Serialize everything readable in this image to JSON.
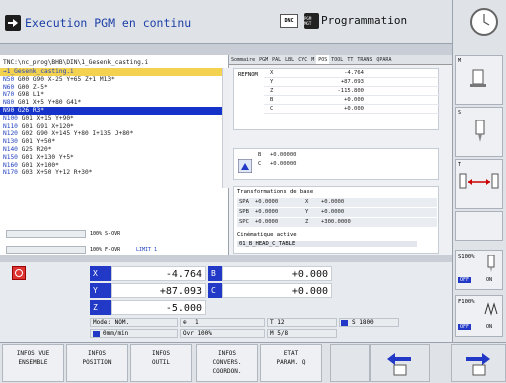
{
  "header": {
    "mode_title": "Execution PGM en continu",
    "dnc": "DNC",
    "prog_icon": "PGM MGT",
    "prog_title": "Programmation"
  },
  "program": {
    "path": "TNC:\\nc_prog\\BHB\\DIN\\1_Gesenk_casting.i",
    "lines": [
      {
        "n": "→1_Gesenk_casting.i",
        "t": "",
        "style": "yellow"
      },
      {
        "n": "N50",
        "t": " G00 G90 X-25 Y+65 Z+1 M13*",
        "style": ""
      },
      {
        "n": "N60",
        "t": " G00 Z-5*",
        "style": ""
      },
      {
        "n": "N70",
        "t": " G98 L1*",
        "style": ""
      },
      {
        "n": "N80",
        "t": " G01 X+5 Y+80 G41*",
        "style": ""
      },
      {
        "n": "N90",
        "t": " G26 R3*",
        "style": "blue"
      },
      {
        "n": "N100",
        "t": " G01 X+15 Y+90*",
        "style": ""
      },
      {
        "n": "N110",
        "t": " G01 G91 X+120*",
        "style": ""
      },
      {
        "n": "N120",
        "t": " G02 G90 X+145 Y+80 I+135 J+80*",
        "style": ""
      },
      {
        "n": "N130",
        "t": " G01 Y+50*",
        "style": ""
      },
      {
        "n": "N140",
        "t": " G25 R20*",
        "style": ""
      },
      {
        "n": "N150",
        "t": " G01 X+130 Y+5*",
        "style": ""
      },
      {
        "n": "N160",
        "t": " G01 X+100*",
        "style": ""
      },
      {
        "n": "N170",
        "t": " G03 X+50 Y+12 R+30*",
        "style": ""
      }
    ],
    "ovr_s": "100% S-OVR",
    "ovr_f": "100% F-OVR",
    "limit": "LIMIT 1"
  },
  "status": {
    "tabs": [
      "Sommaire",
      "PGM",
      "PAL",
      "LBL",
      "CYC",
      "M",
      "POS",
      "TOOL",
      "TT",
      "TRANS",
      "QPARA"
    ],
    "active_tab": "POS",
    "refnom": "REFNOM",
    "pos": [
      {
        "a": "X",
        "v": "-4.764"
      },
      {
        "a": "Y",
        "v": "+87.093"
      },
      {
        "a": "Z",
        "v": "-115.800"
      },
      {
        "a": "B",
        "v": "+0.000"
      },
      {
        "a": "C",
        "v": "+0.000"
      }
    ],
    "rot": [
      {
        "a": "B",
        "v": "+0.00000"
      },
      {
        "a": "C",
        "v": "+0.00000"
      }
    ],
    "trans_title": "Transformations de base",
    "trans": [
      {
        "k": "SPA",
        "v": "+0.0000",
        "a": "X",
        "w": "+0.0000"
      },
      {
        "k": "SPB",
        "v": "+0.0000",
        "a": "Y",
        "w": "+0.0000"
      },
      {
        "k": "SPC",
        "v": "+0.0000",
        "a": "Z",
        "w": "+300.0000"
      }
    ],
    "kin_title": "Cinématique active",
    "kin": "01_B_HEAD_C_TABLE"
  },
  "big": {
    "axes": [
      {
        "a": "X",
        "v": "-4.764"
      },
      {
        "a": "Y",
        "v": "+87.093"
      },
      {
        "a": "Z",
        "v": "-5.000"
      }
    ],
    "axes2": [
      {
        "a": "B",
        "v": "+0.000"
      },
      {
        "a": "C",
        "v": "+0.000"
      }
    ],
    "mode": "Mode: NOM.",
    "feed": "0mm/min",
    "ovr": "Ovr 100%",
    "tool_line": "1",
    "t": "T 12",
    "s": "S 1800",
    "m": "M 5/8"
  },
  "side": {
    "s_pct": "S100%",
    "f_pct": "F100%",
    "off": "OFF",
    "on": "ON"
  },
  "fkeys": [
    {
      "l1": "INFOS VUE",
      "l2": "ENSEMBLE",
      "l3": ""
    },
    {
      "l1": "INFOS",
      "l2": "POSITION",
      "l3": ""
    },
    {
      "l1": "INFOS",
      "l2": "OUTIL",
      "l3": ""
    },
    {
      "l1": "INFOS",
      "l2": "CONVERS.",
      "l3": "COORDON."
    },
    {
      "l1": "ETAT",
      "l2": "PARAM. Q",
      "l3": ""
    }
  ],
  "colors": {
    "accent_blue": "#2238c6",
    "highlight_yellow": "#f3d250",
    "select_blue": "#1533c8"
  }
}
